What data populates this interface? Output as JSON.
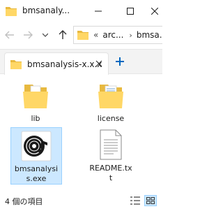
{
  "window": {
    "title": "bmsanalysis-x.x.x",
    "title_display": "bmsanaly..."
  },
  "address": {
    "overflow_label": "«",
    "segments": [
      "arc...",
      "bmsa..."
    ]
  },
  "tabs": [
    {
      "label": "bmsanalysis-x.x.x"
    }
  ],
  "items": [
    {
      "name": "lib",
      "type": "folder"
    },
    {
      "name": "license",
      "type": "folder"
    },
    {
      "name": "bmsanalysi\ns.exe",
      "type": "exe"
    },
    {
      "name": "README.tx\nt",
      "type": "text"
    }
  ],
  "status": {
    "text": "4 個の項目"
  },
  "colors": {
    "folder": "#ffd766",
    "folder_dark": "#e8b93f",
    "selection": "#cce8ff",
    "accent": "#0067c0"
  }
}
